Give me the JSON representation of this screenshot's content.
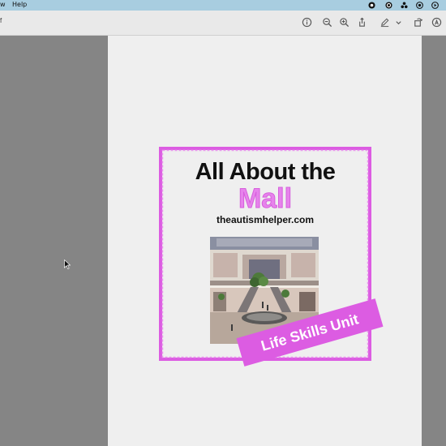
{
  "menubar": {
    "items": [
      "w",
      "Help"
    ]
  },
  "toolbar": {
    "doc_label": "f"
  },
  "cover": {
    "title_line1": "All About the",
    "title_line2": "Mall",
    "website": "theautismhelper.com",
    "banner": "Life Skills Unit",
    "accent_color": "#dc5ce2"
  },
  "icons": [
    "info-icon",
    "zoom-out-icon",
    "zoom-in-icon",
    "share-icon",
    "markup-pen-icon",
    "chevron-down-icon",
    "rotate-icon",
    "accessibility-icon"
  ]
}
